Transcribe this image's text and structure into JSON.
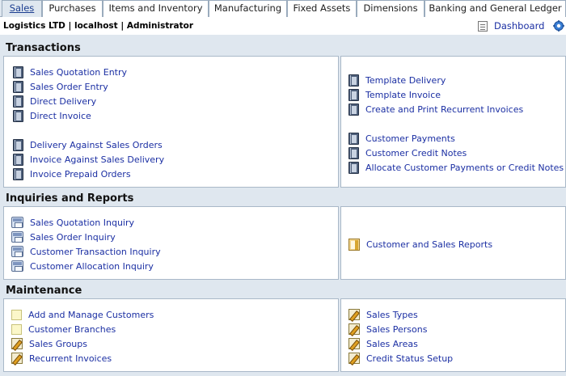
{
  "tabs": [
    {
      "label": "Sales",
      "active": true
    },
    {
      "label": "Purchases",
      "active": false
    },
    {
      "label": "Items and Inventory",
      "active": false
    },
    {
      "label": "Manufacturing",
      "active": false
    },
    {
      "label": "Fixed Assets",
      "active": false
    },
    {
      "label": "Dimensions",
      "active": false
    },
    {
      "label": "Banking and General Ledger",
      "active": false
    }
  ],
  "header": {
    "company": "Logistics LTD | localhost | Administrator",
    "dashboard_label": "Dashboard",
    "dashboard_icon": "dashboard-icon",
    "settings_icon": "gear-icon"
  },
  "transactions": {
    "title": "Transactions",
    "left": [
      {
        "label": "Sales Quotation Entry",
        "icon": "book-icon"
      },
      {
        "label": "Sales Order Entry",
        "icon": "book-icon"
      },
      {
        "label": "Direct Delivery",
        "icon": "book-icon"
      },
      {
        "label": "Direct Invoice",
        "icon": "book-icon"
      },
      {
        "label": "Delivery Against Sales Orders",
        "icon": "book-icon"
      },
      {
        "label": "Invoice Against Sales Delivery",
        "icon": "book-icon"
      },
      {
        "label": "Invoice Prepaid Orders",
        "icon": "book-icon"
      }
    ],
    "right": [
      {
        "label": "Template Delivery",
        "icon": "book-icon"
      },
      {
        "label": "Template Invoice",
        "icon": "book-icon"
      },
      {
        "label": "Create and Print Recurrent Invoices",
        "icon": "book-icon"
      },
      {
        "label": "Customer Payments",
        "icon": "book-icon"
      },
      {
        "label": "Customer Credit Notes",
        "icon": "book-icon"
      },
      {
        "label": "Allocate Customer Payments or Credit Notes",
        "icon": "book-icon"
      }
    ]
  },
  "inquiries": {
    "title": "Inquiries and Reports",
    "left": [
      {
        "label": "Sales Quotation Inquiry",
        "icon": "search-icon"
      },
      {
        "label": "Sales Order Inquiry",
        "icon": "search-icon"
      },
      {
        "label": "Customer Transaction Inquiry",
        "icon": "search-icon"
      },
      {
        "label": "Customer Allocation Inquiry",
        "icon": "search-icon"
      }
    ],
    "right": [
      {
        "label": "Customer and Sales Reports",
        "icon": "report-icon"
      }
    ]
  },
  "maintenance": {
    "title": "Maintenance",
    "left": [
      {
        "label": "Add and Manage Customers",
        "icon": "note-icon"
      },
      {
        "label": "Customer Branches",
        "icon": "note-icon"
      },
      {
        "label": "Sales Groups",
        "icon": "edit-icon"
      },
      {
        "label": "Recurrent Invoices",
        "icon": "edit-icon"
      }
    ],
    "right": [
      {
        "label": "Sales Types",
        "icon": "edit-icon"
      },
      {
        "label": "Sales Persons",
        "icon": "edit-icon"
      },
      {
        "label": "Sales Areas",
        "icon": "edit-icon"
      },
      {
        "label": "Credit Status Setup",
        "icon": "edit-icon"
      }
    ]
  },
  "colors": {
    "link": "#1b2fa3",
    "background": "#dfe7ef",
    "panel_border": "#a9b8c8"
  }
}
